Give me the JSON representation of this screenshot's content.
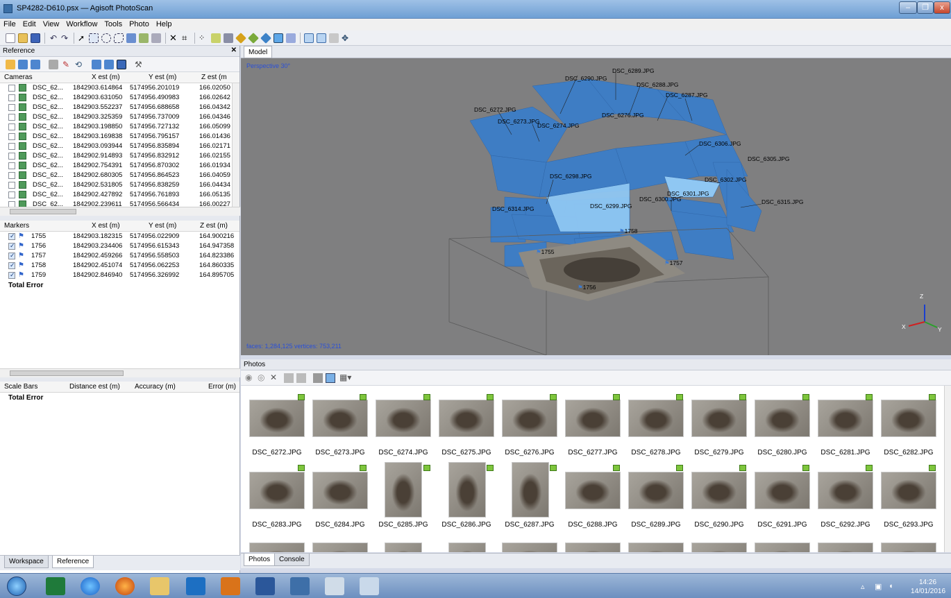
{
  "window": {
    "title": "SP4282-D610.psx — Agisoft PhotoScan",
    "min": "–",
    "max": "❐",
    "close": "x"
  },
  "menu": [
    "File",
    "Edit",
    "View",
    "Workflow",
    "Tools",
    "Photo",
    "Help"
  ],
  "reference": {
    "title": "Reference",
    "close": "✕",
    "cameras": {
      "headers": [
        "Cameras",
        "X est (m)",
        "Y est (m)",
        "Z est (m"
      ],
      "rows": [
        [
          "DSC_62...",
          "1842903.614864",
          "5174956.201019",
          "166.02050"
        ],
        [
          "DSC_62...",
          "1842903.631050",
          "5174956.490983",
          "166.02642"
        ],
        [
          "DSC_62...",
          "1842903.552237",
          "5174956.688658",
          "166.04342"
        ],
        [
          "DSC_62...",
          "1842903.325359",
          "5174956.737009",
          "166.04346"
        ],
        [
          "DSC_62...",
          "1842903.198850",
          "5174956.727132",
          "166.05099"
        ],
        [
          "DSC_62...",
          "1842903.169838",
          "5174956.795157",
          "166.01436"
        ],
        [
          "DSC_62...",
          "1842903.093944",
          "5174956.835894",
          "166.02171"
        ],
        [
          "DSC_62...",
          "1842902.914893",
          "5174956.832912",
          "166.02155"
        ],
        [
          "DSC_62...",
          "1842902.754391",
          "5174956.870302",
          "166.01934"
        ],
        [
          "DSC_62...",
          "1842902.680305",
          "5174956.864523",
          "166.04059"
        ],
        [
          "DSC_62...",
          "1842902.531805",
          "5174956.838259",
          "166.04434"
        ],
        [
          "DSC_62...",
          "1842902.427892",
          "5174956.761893",
          "166.05135"
        ],
        [
          "DSC_62...",
          "1842902.239611",
          "5174956.566434",
          "166.00227"
        ]
      ]
    },
    "markers": {
      "headers": [
        "Markers",
        "X est (m)",
        "Y est (m)",
        "Z est (m)"
      ],
      "rows": [
        [
          "1755",
          "1842903.182315",
          "5174956.022909",
          "164.900216"
        ],
        [
          "1756",
          "1842903.234406",
          "5174956.615343",
          "164.947358"
        ],
        [
          "1757",
          "1842902.459266",
          "5174956.558503",
          "164.823386"
        ],
        [
          "1758",
          "1842902.451074",
          "5174956.062253",
          "164.860335"
        ],
        [
          "1759",
          "1842902.846940",
          "5174956.326992",
          "164.895705"
        ]
      ],
      "total": "Total Error"
    },
    "scalebars": {
      "headers": [
        "Scale Bars",
        "Distance est (m)",
        "Accuracy (m)",
        "Error (m)"
      ],
      "total": "Total Error"
    },
    "tabs": [
      "Workspace",
      "Reference"
    ]
  },
  "model": {
    "tab": "Model",
    "perspective": "Perspective 30°",
    "stats": "faces: 1,284,125 vertices: 753,211",
    "camera_labels": [
      "DSC_6290.JPG",
      "DSC_6289.JPG",
      "DSC_6288.JPG",
      "DSC_6287.JPG",
      "DSC_6272.JPG",
      "DSC_6273.JPG",
      "DSC_6274.JPG",
      "DSC_6276.JPG",
      "DSC_6306.JPG",
      "DSC_6305.JPG",
      "DSC_6298.JPG",
      "DSC_6302.JPG",
      "DSC_6301.JPG",
      "DSC_6300.JPG",
      "DSC_6299.JPG",
      "DSC_6314.JPG",
      "DSC_6315.JPG"
    ],
    "markers": [
      "1755",
      "1756",
      "1757",
      "1758"
    ],
    "axes": {
      "z": "Z",
      "x": "X",
      "y": "Y"
    }
  },
  "photos": {
    "title": "Photos",
    "row1": [
      "DSC_6272.JPG",
      "DSC_6273.JPG",
      "DSC_6274.JPG",
      "DSC_6275.JPG",
      "DSC_6276.JPG",
      "DSC_6277.JPG",
      "DSC_6278.JPG",
      "DSC_6279.JPG",
      "DSC_6280.JPG",
      "DSC_6281.JPG",
      "DSC_6282.JPG"
    ],
    "row2": [
      "DSC_6283.JPG",
      "DSC_6284.JPG",
      "DSC_6285.JPG",
      "DSC_6286.JPG",
      "DSC_6287.JPG",
      "DSC_6288.JPG",
      "DSC_6289.JPG",
      "DSC_6290.JPG",
      "DSC_6291.JPG",
      "DSC_6292.JPG",
      "DSC_6293.JPG"
    ],
    "tabs": [
      "Photos",
      "Console"
    ]
  },
  "taskbar": {
    "time": "14:26",
    "date": "14/01/2016"
  }
}
